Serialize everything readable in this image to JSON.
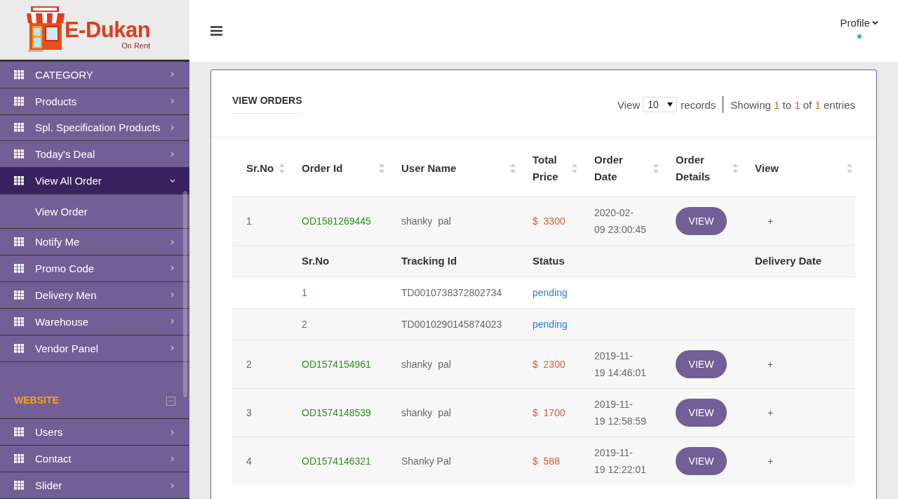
{
  "logo": {
    "title": "E-Dukan",
    "subtitle": "On Rent"
  },
  "sidebar": {
    "items": [
      {
        "label": "CATEGORY",
        "expanded": false
      },
      {
        "label": "Products",
        "expanded": false
      },
      {
        "label": "Spl. Specification Products",
        "expanded": false
      },
      {
        "label": "Today's Deal",
        "expanded": false
      },
      {
        "label": "View All Order",
        "expanded": true,
        "children": [
          {
            "label": "View Order"
          }
        ]
      },
      {
        "label": "Notify Me",
        "expanded": false
      },
      {
        "label": "Promo Code",
        "expanded": false
      },
      {
        "label": "Delivery Men",
        "expanded": false
      },
      {
        "label": "Warehouse",
        "expanded": false
      },
      {
        "label": "Vendor Panel",
        "expanded": false
      }
    ],
    "section": {
      "title": "WEBSITE",
      "expanded": true,
      "items": [
        {
          "label": "Users",
          "expanded": false
        },
        {
          "label": "Contact",
          "expanded": false
        },
        {
          "label": "Slider",
          "expanded": false
        }
      ]
    }
  },
  "header": {
    "profile": "Profile"
  },
  "card": {
    "title": "VIEW ORDERS",
    "view_label": "View",
    "page_size": "10",
    "records_label": "records",
    "showing": [
      "Showing",
      "1",
      "to",
      "1",
      "of",
      "1",
      "entries"
    ]
  },
  "table": {
    "columns": [
      "Sr.No",
      "Order Id",
      "User Name",
      "Total Price",
      "Order Date",
      "Order Details",
      "View"
    ],
    "detail_columns": [
      "Sr.No",
      "Tracking Id",
      "Status",
      "Delivery Date"
    ],
    "rows": [
      {
        "sr": "1",
        "order_id": "OD1581269445",
        "user": "shanky  pal",
        "currency": "$",
        "price": "3300",
        "date": "2020-02-09 23:00:45",
        "button": "VIEW",
        "toggle": "+",
        "details": [
          {
            "sr": "1",
            "tracking_id": "TD0010738372802734",
            "status": "pending"
          },
          {
            "sr": "2",
            "tracking_id": "TD0010290145874023",
            "status": "pending"
          }
        ]
      },
      {
        "sr": "2",
        "order_id": "OD1574154961",
        "user": "shanky  pal",
        "currency": "$",
        "price": "2300",
        "date": "2019-11-19 14:46:01",
        "button": "VIEW",
        "toggle": "+"
      },
      {
        "sr": "3",
        "order_id": "OD1574148539",
        "user": "shanky  pal",
        "currency": "$",
        "price": "1700",
        "date": "2019-11-19 12:58:59",
        "button": "VIEW",
        "toggle": "+"
      },
      {
        "sr": "4",
        "order_id": "OD1574146321",
        "user": "Shanky Pal",
        "currency": "$",
        "price": "588",
        "date": "2019-11-19 12:22:01",
        "button": "VIEW",
        "toggle": "+"
      }
    ]
  }
}
